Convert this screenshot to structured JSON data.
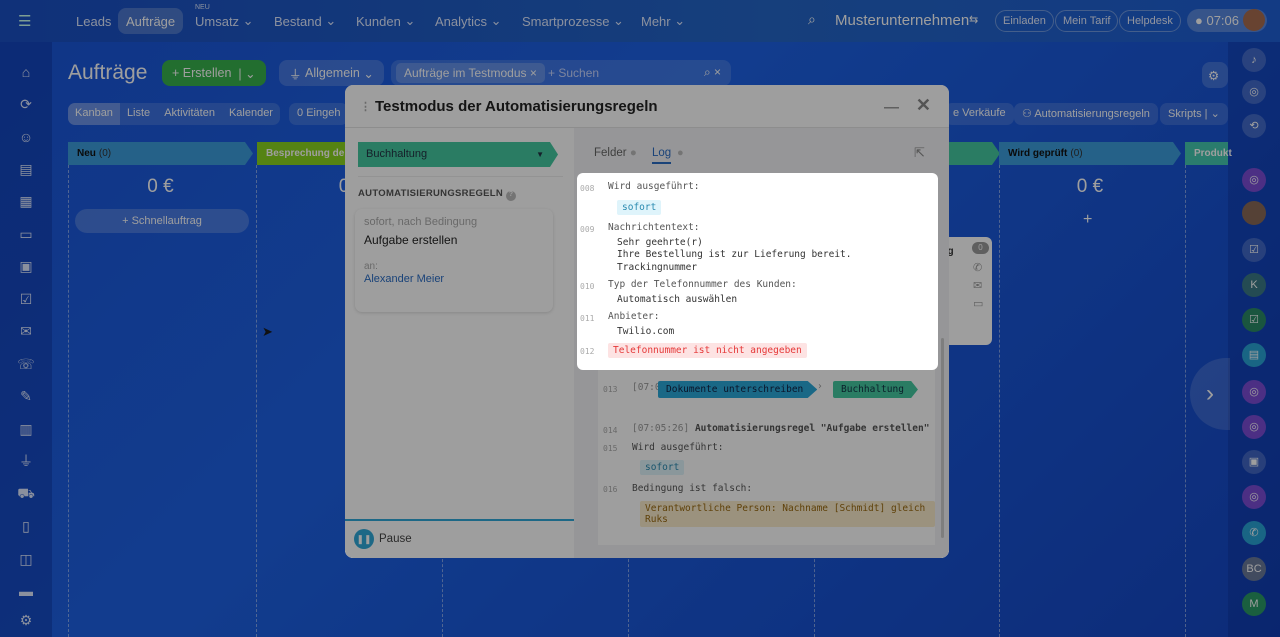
{
  "topnav": {
    "items": [
      "Leads",
      "Aufträge",
      "Umsatz",
      "Bestand",
      "Kunden",
      "Analytics",
      "Smartprozesse",
      "Mehr"
    ],
    "neu_badge": "NEU",
    "company": "Musterunternehmen",
    "buttons": [
      "Einladen",
      "Mein Tarif",
      "Helpdesk"
    ],
    "time": "07:06"
  },
  "page": {
    "title": "Aufträge",
    "create": "Erstellen",
    "filter": "Allgemein",
    "filter_tag": "Aufträge im Testmodus",
    "search_placeholder": "+ Suchen",
    "views": [
      "Kanban",
      "Liste",
      "Aktivitäten",
      "Kalender"
    ],
    "incoming_count": "0",
    "incoming": "Eingeh",
    "sales": "e Verkäufe",
    "automation": "Automatisierungsregeln",
    "scripts": "Skripts"
  },
  "kanban": {
    "columns": [
      {
        "name": "Neu",
        "count": "(0)",
        "sum": "0 €",
        "color": "#2f8fcf"
      },
      {
        "name": "Besprechung der",
        "count": "",
        "sum": "0",
        "color": "#7cc41a"
      },
      {
        "name": "Wird geprüft",
        "count": "(0)",
        "sum": "0 €",
        "color": "#2f8fcf"
      },
      {
        "name": "Produkt",
        "count": "",
        "sum": "",
        "color": "#35c4a8"
      }
    ],
    "quick_order": "Schnellauftrag",
    "card_title": "ag",
    "card_count": "0"
  },
  "modal": {
    "title": "Testmodus der Automatisierungsregeln",
    "stage": "Buchhaltung",
    "rules_header": "AUTOMATISIERUNGSREGELN",
    "rule": {
      "when": "sofort, nach Bedingung",
      "name": "Aufgabe erstellen",
      "to_label": "an:",
      "to": "Alexander Meier"
    },
    "pause": "Pause",
    "tabs": [
      "Felder",
      "Log"
    ],
    "log": [
      {
        "n": "008",
        "text": "Wird ausgeführt:"
      },
      {
        "tag": "sofort"
      },
      {
        "n": "009",
        "text": "Nachrichtentext:"
      },
      {
        "lines": [
          "Sehr geehrte(r)",
          "Ihre Bestellung ist zur Lieferung bereit.",
          "Trackingnummer"
        ]
      },
      {
        "n": "010",
        "text": "Typ der Telefonnummer des Kunden:"
      },
      {
        "value": "Automatisch auswählen"
      },
      {
        "n": "011",
        "text": "Anbieter:"
      },
      {
        "value": "Twilio.com"
      },
      {
        "n": "012",
        "error": "Telefonnummer ist nicht angegeben"
      },
      {
        "n": "013",
        "time": "[07:05:26]",
        "from": "Dokumente unterschreiben",
        "to": "Buchhaltung"
      },
      {
        "n": "014",
        "time": "[07:05:26]",
        "text": "Automatisierungsregel \"Aufgabe erstellen\""
      },
      {
        "n": "015",
        "text": "Wird ausgeführt:"
      },
      {
        "tag": "sofort"
      },
      {
        "n": "016",
        "text": "Bedingung ist falsch:"
      },
      {
        "condition": "Verantwortliche Person: Nachname [Schmidt] gleich Ruks"
      }
    ]
  }
}
